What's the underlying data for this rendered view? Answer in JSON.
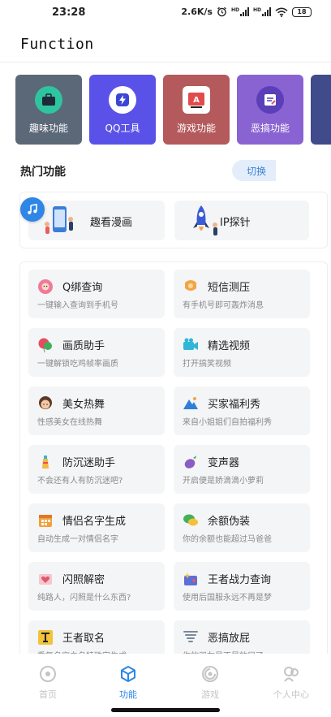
{
  "status_bar": {
    "time": "23:28",
    "net_speed": "2.6K/s",
    "battery": "18"
  },
  "header": {
    "title": "Function"
  },
  "categories": [
    {
      "label": "趣味功能",
      "bg": "#5b6878",
      "icon": "briefcase-icon"
    },
    {
      "label": "QQ工具",
      "bg": "#5a52e8",
      "icon": "lightning-icon"
    },
    {
      "label": "游戏功能",
      "bg": "#b45a5c",
      "icon": "game-icon"
    },
    {
      "label": "恶搞功能",
      "bg": "#8a63d2",
      "icon": "edit-icon"
    }
  ],
  "hot": {
    "title": "热门功能",
    "switch_label": "切换",
    "items": [
      {
        "label": "趣看漫画",
        "icon": "phone-illustration-icon"
      },
      {
        "label": "IP探针",
        "icon": "rocket-illustration-icon"
      }
    ]
  },
  "features": [
    {
      "title": "Q绑查询",
      "desc": "一键输入查询到手机号",
      "color": "#f07a9a",
      "icon": "flower-icon"
    },
    {
      "title": "短信测压",
      "desc": "有手机号即可轰炸消息",
      "color": "#f2a544",
      "icon": "sms-icon"
    },
    {
      "title": "画质助手",
      "desc": "一键解锁吃鸡帧率画质",
      "color": "#e84a5f",
      "icon": "balloon-icon"
    },
    {
      "title": "精选视频",
      "desc": "打开搞笑视频",
      "color": "#31b6d8",
      "icon": "video-icon"
    },
    {
      "title": "美女热舞",
      "desc": "性感美女在线热舞",
      "color": "#5a3a26",
      "icon": "girl-icon"
    },
    {
      "title": "买家福利秀",
      "desc": "来自小姐姐们自拍福利秀",
      "color": "#2f7fd8",
      "icon": "mountain-icon"
    },
    {
      "title": "防沉迷助手",
      "desc": "不会还有人有防沉迷吧?",
      "color": "#f5b942",
      "icon": "lighthouse-icon"
    },
    {
      "title": "变声器",
      "desc": "开启便是娇滴滴小萝莉",
      "color": "#8b5cc4",
      "icon": "eggplant-icon"
    },
    {
      "title": "情侣名字生成",
      "desc": "自动生成一对情侣名字",
      "color": "#f2a13a",
      "icon": "calendar-icon"
    },
    {
      "title": "余额伪装",
      "desc": "你的余额也能超过马爸爸",
      "color": "#43b05c",
      "icon": "chat-icon"
    },
    {
      "title": "闪照解密",
      "desc": "纯路人，闪照是什么东西?",
      "color": "#e2566b",
      "icon": "photo-heart-icon"
    },
    {
      "title": "王者战力查询",
      "desc": "使用后国服永远不再是梦",
      "color": "#5b6fd6",
      "icon": "sparkle-card-icon"
    },
    {
      "title": "王者取名",
      "desc": "重复名空白名特殊字生成",
      "color": "#f2c23a",
      "icon": "text-cursor-icon"
    },
    {
      "title": "恶搞放屁",
      "desc": "你的朋友是不是放屁了",
      "color": "#7a8a9a",
      "icon": "tornado-icon"
    }
  ],
  "nav": [
    {
      "label": "首页",
      "icon": "home-circle-icon",
      "active": false
    },
    {
      "label": "功能",
      "icon": "cube-icon",
      "active": true
    },
    {
      "label": "游戏",
      "icon": "game-swirl-icon",
      "active": false
    },
    {
      "label": "个人中心",
      "icon": "person-icon",
      "active": false
    }
  ],
  "colors": {
    "accent": "#2f86e6",
    "card_bg": "#f4f5f7"
  }
}
